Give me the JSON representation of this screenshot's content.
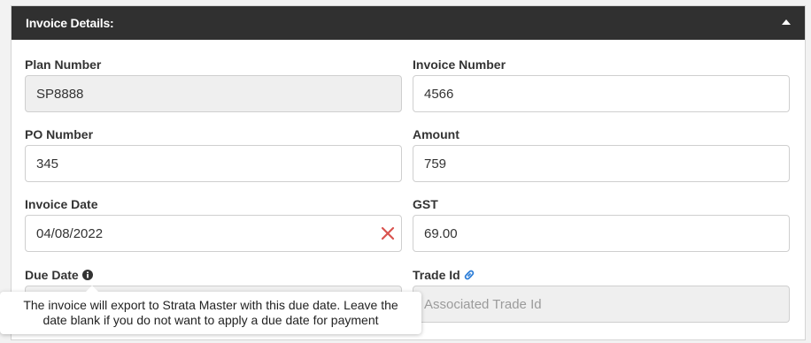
{
  "panel": {
    "title": "Invoice Details:"
  },
  "fields": {
    "plan_number": {
      "label": "Plan Number",
      "value": "SP8888"
    },
    "invoice_number": {
      "label": "Invoice Number",
      "value": "4566"
    },
    "po_number": {
      "label": "PO Number",
      "value": "345"
    },
    "amount": {
      "label": "Amount",
      "value": "759"
    },
    "invoice_date": {
      "label": "Invoice Date",
      "value": "04/08/2022"
    },
    "gst": {
      "label": "GST",
      "value": "69.00"
    },
    "due_date": {
      "label": "Due Date",
      "value": ""
    },
    "trade_id": {
      "label": "Trade Id",
      "value": "",
      "placeholder": "Associated Trade Id"
    }
  },
  "tooltip": {
    "line1": "The invoice will export to Strata Master with this due date. Leave the",
    "line2": "date blank if you do not want to apply a due date for payment"
  },
  "colors": {
    "header_bg": "#303030",
    "clear_icon": "#d9534f",
    "link_icon": "#2f7fd8"
  },
  "icons": {
    "collapse": "caret-up-icon",
    "clear": "close-icon",
    "info": "info-icon",
    "link": "link-icon"
  }
}
